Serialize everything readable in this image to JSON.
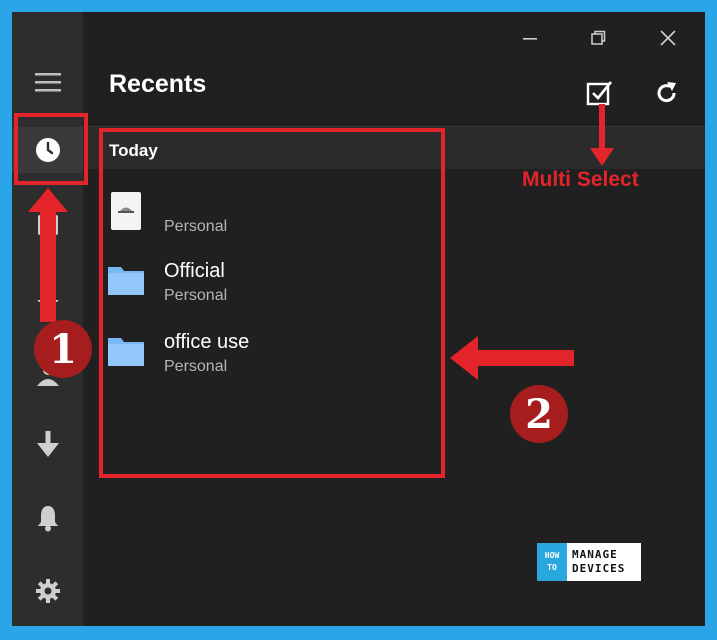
{
  "window": {
    "controls": {
      "minimize": "minimize-icon",
      "restore": "restore-icon",
      "close": "close-icon"
    }
  },
  "sidebar": {
    "items": [
      {
        "name": "hamburger-menu-icon"
      },
      {
        "name": "clock-icon",
        "active": true
      },
      {
        "name": "file-icon"
      },
      {
        "name": "star-icon"
      },
      {
        "name": "people-icon"
      },
      {
        "name": "download-icon"
      },
      {
        "name": "bell-icon"
      },
      {
        "name": "settings-gear-icon"
      }
    ]
  },
  "header": {
    "title": "Recents",
    "multiselect_icon": "checkbox-icon",
    "refresh_icon": "refresh-icon"
  },
  "recents": {
    "group_label": "Today",
    "items": [
      {
        "name": "",
        "location": "Personal",
        "icon": "document-icon"
      },
      {
        "name": "Official",
        "location": "Personal",
        "icon": "folder-icon"
      },
      {
        "name": "office use",
        "location": "Personal",
        "icon": "folder-icon"
      }
    ]
  },
  "annotations": {
    "multi_select_label": "Multi Select",
    "step1": "1",
    "step2": "2",
    "color": "#e3242b"
  },
  "logo": {
    "left_top": "HOW",
    "left_bottom": "TO",
    "right_top": "MANAGE",
    "right_bottom": "DEVICES"
  }
}
